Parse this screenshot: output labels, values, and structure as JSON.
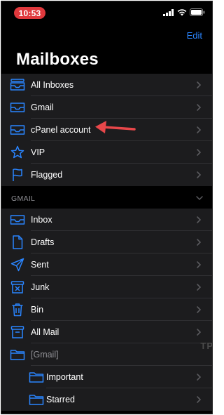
{
  "status_bar": {
    "time": "10:53"
  },
  "header": {
    "edit_label": "Edit",
    "title": "Mailboxes"
  },
  "mailboxes": [
    {
      "label": "All Inboxes",
      "icon": "tray-stack-icon"
    },
    {
      "label": "Gmail",
      "icon": "tray-icon"
    },
    {
      "label": "cPanel account",
      "icon": "tray-icon"
    },
    {
      "label": "VIP",
      "icon": "star-icon"
    },
    {
      "label": "Flagged",
      "icon": "flag-icon"
    }
  ],
  "gmail_section": {
    "header": "GMAIL",
    "items": [
      {
        "label": "Inbox",
        "icon": "tray-icon"
      },
      {
        "label": "Drafts",
        "icon": "document-icon"
      },
      {
        "label": "Sent",
        "icon": "paperplane-icon"
      },
      {
        "label": "Junk",
        "icon": "junk-bin-icon"
      },
      {
        "label": "Bin",
        "icon": "trash-icon"
      },
      {
        "label": "All Mail",
        "icon": "archive-box-icon"
      },
      {
        "label": "[Gmail]",
        "icon": "folder-icon"
      },
      {
        "label": "Important",
        "icon": "folder-icon"
      },
      {
        "label": "Starred",
        "icon": "folder-icon"
      }
    ]
  },
  "watermark": "TP",
  "colors": {
    "accent": "#2a85ff",
    "background": "#000000",
    "row_bg": "#1c1c1e",
    "annotation_arrow": "#e8474a",
    "time_pill": "#e0383c"
  }
}
